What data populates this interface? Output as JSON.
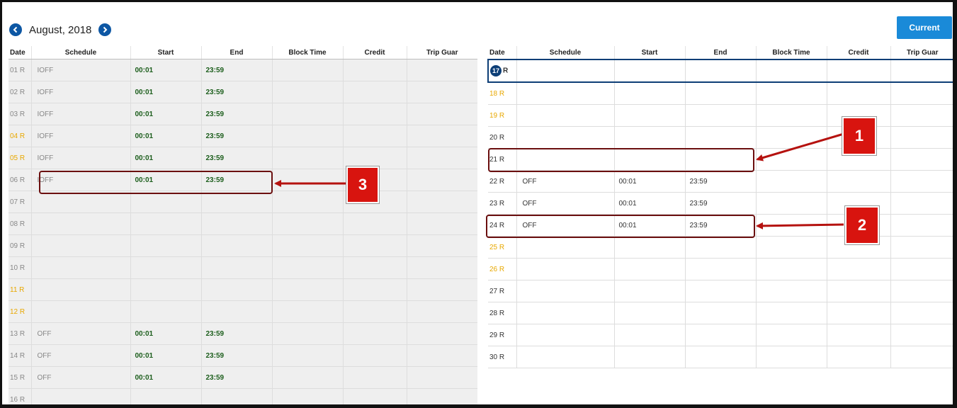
{
  "header": {
    "month_label": "August, 2018",
    "prev_icon": "chevron-left-circle-icon",
    "next_icon": "chevron-right-circle-icon",
    "current_button": "Current"
  },
  "colors": {
    "accent": "#1a8ad8",
    "nav": "#0d57a4",
    "weekend": "#e8a800",
    "time_green": "#1c5e1c",
    "callout_red": "#d8140f"
  },
  "columns": [
    "Date",
    "Schedule",
    "Start",
    "End",
    "Block Time",
    "Credit",
    "Trip Guar"
  ],
  "left_rows": [
    {
      "date": "01 R",
      "schedule": "IOFF",
      "start": "00:01",
      "end": "23:59",
      "weekend": false
    },
    {
      "date": "02 R",
      "schedule": "IOFF",
      "start": "00:01",
      "end": "23:59",
      "weekend": false
    },
    {
      "date": "03 R",
      "schedule": "IOFF",
      "start": "00:01",
      "end": "23:59",
      "weekend": false
    },
    {
      "date": "04 R",
      "schedule": "IOFF",
      "start": "00:01",
      "end": "23:59",
      "weekend": true
    },
    {
      "date": "05 R",
      "schedule": "IOFF",
      "start": "00:01",
      "end": "23:59",
      "weekend": true
    },
    {
      "date": "06 R",
      "schedule": "IOFF",
      "start": "00:01",
      "end": "23:59",
      "weekend": false
    },
    {
      "date": "07 R",
      "schedule": "",
      "start": "",
      "end": "",
      "weekend": false
    },
    {
      "date": "08 R",
      "schedule": "",
      "start": "",
      "end": "",
      "weekend": false
    },
    {
      "date": "09 R",
      "schedule": "",
      "start": "",
      "end": "",
      "weekend": false
    },
    {
      "date": "10 R",
      "schedule": "",
      "start": "",
      "end": "",
      "weekend": false
    },
    {
      "date": "11 R",
      "schedule": "",
      "start": "",
      "end": "",
      "weekend": true
    },
    {
      "date": "12 R",
      "schedule": "",
      "start": "",
      "end": "",
      "weekend": true
    },
    {
      "date": "13 R",
      "schedule": "OFF",
      "start": "00:01",
      "end": "23:59",
      "weekend": false
    },
    {
      "date": "14 R",
      "schedule": "OFF",
      "start": "00:01",
      "end": "23:59",
      "weekend": false
    },
    {
      "date": "15 R",
      "schedule": "OFF",
      "start": "00:01",
      "end": "23:59",
      "weekend": false
    },
    {
      "date": "16 R",
      "schedule": "",
      "start": "",
      "end": "",
      "weekend": false
    }
  ],
  "right_rows": [
    {
      "date": "17",
      "suffix": "R",
      "today": true,
      "schedule": "",
      "start": "",
      "end": "",
      "weekend": false
    },
    {
      "date": "18 R",
      "schedule": "",
      "start": "",
      "end": "",
      "weekend": true
    },
    {
      "date": "19 R",
      "schedule": "",
      "start": "",
      "end": "",
      "weekend": true
    },
    {
      "date": "20 R",
      "schedule": "",
      "start": "",
      "end": "",
      "weekend": false
    },
    {
      "date": "21 R",
      "schedule": "",
      "start": "",
      "end": "",
      "weekend": false
    },
    {
      "date": "22 R",
      "schedule": "OFF",
      "start": "00:01",
      "end": "23:59",
      "weekend": false
    },
    {
      "date": "23 R",
      "schedule": "OFF",
      "start": "00:01",
      "end": "23:59",
      "weekend": false
    },
    {
      "date": "24 R",
      "schedule": "OFF",
      "start": "00:01",
      "end": "23:59",
      "weekend": false
    },
    {
      "date": "25 R",
      "schedule": "",
      "start": "",
      "end": "",
      "weekend": true
    },
    {
      "date": "26 R",
      "schedule": "",
      "start": "",
      "end": "",
      "weekend": true
    },
    {
      "date": "27 R",
      "schedule": "",
      "start": "",
      "end": "",
      "weekend": false
    },
    {
      "date": "28 R",
      "schedule": "",
      "start": "",
      "end": "",
      "weekend": false
    },
    {
      "date": "29 R",
      "schedule": "",
      "start": "",
      "end": "",
      "weekend": false
    },
    {
      "date": "30 R",
      "schedule": "",
      "start": "",
      "end": "",
      "weekend": false
    }
  ],
  "callouts": {
    "one": "1",
    "two": "2",
    "three": "3"
  }
}
